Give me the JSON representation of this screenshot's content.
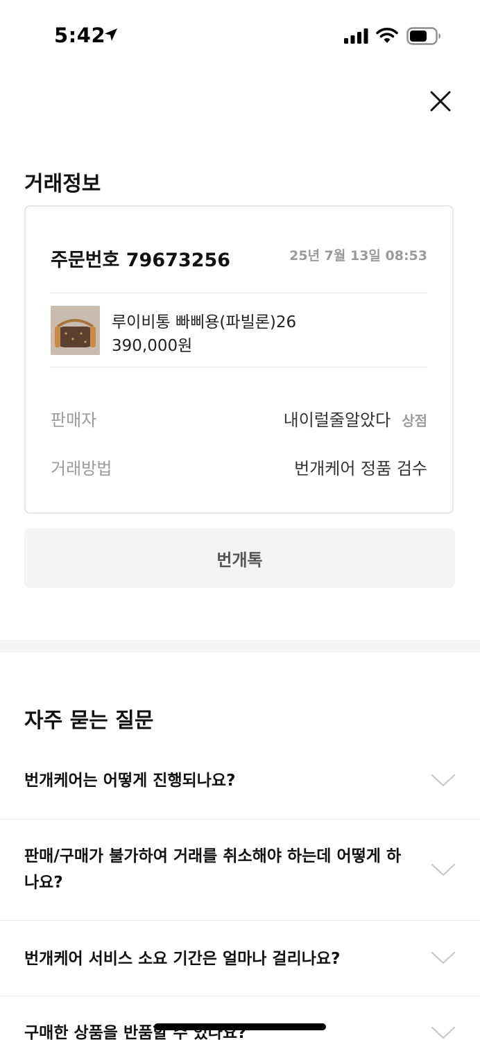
{
  "status_bar": {
    "time": "5:42"
  },
  "section": {
    "trade_info_title": "거래정보",
    "faq_title": "자주 묻는 질문"
  },
  "order": {
    "number_label": "주문번호 79673256",
    "date": "25년 7월 13일 08:53",
    "product_name": "루이비통 빠삐용(파빌론)26",
    "product_price": "390,000원",
    "seller_label": "판매자",
    "seller_name": "내이럴줄알았다",
    "store_link": "상점",
    "method_label": "거래방법",
    "method_value": "번개케어 정품 검수"
  },
  "chat_button": "번개톡",
  "faq": [
    {
      "question": "번개케어는 어떻게 진행되나요?"
    },
    {
      "question": "판매/구매가 불가하여 거래를 취소해야 하는데 어떻게 하나요?"
    },
    {
      "question": "번개케어 서비스 소요 기간은 얼마나 걸리나요?"
    },
    {
      "question": "구매한 상품을 반품할 수 있나요?"
    }
  ],
  "icons": {
    "close": "close-icon",
    "chevron": "chevron-down-icon",
    "location": "location-arrow-icon",
    "signal": "cellular-signal-icon",
    "wifi": "wifi-icon",
    "battery": "battery-icon"
  },
  "colors": {
    "muted_text": "#9b9b9b",
    "button_bg": "#f3f3f3",
    "border": "#e7e7e7"
  }
}
